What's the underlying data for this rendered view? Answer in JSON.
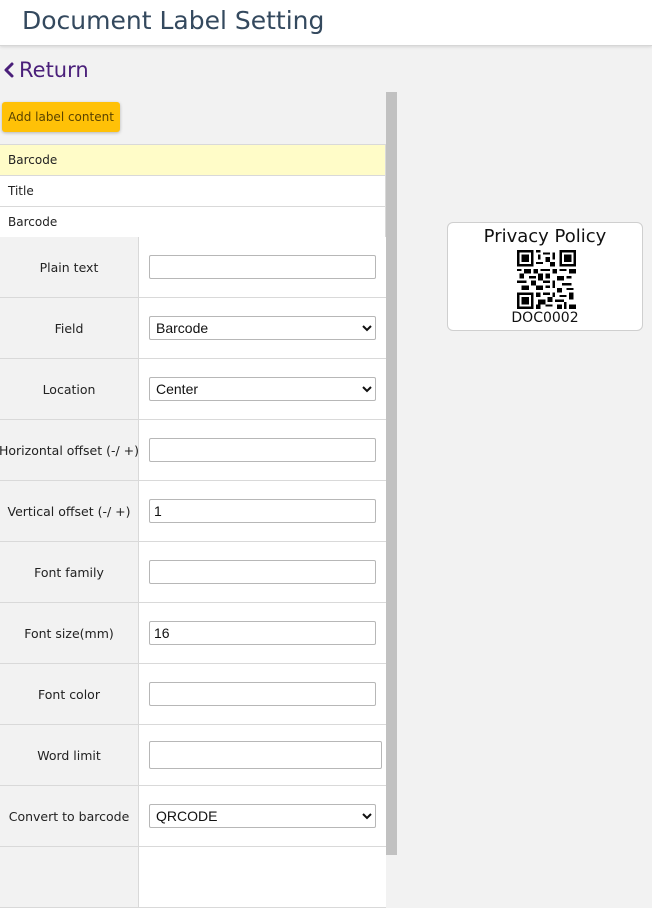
{
  "page": {
    "title": "Document Label Setting"
  },
  "nav": {
    "return_label": "Return"
  },
  "panel": {
    "add_button_label": "Add label content",
    "items": [
      {
        "label": "Barcode",
        "selected": true
      },
      {
        "label": "Title",
        "selected": false
      },
      {
        "label": "Barcode",
        "selected": false
      }
    ]
  },
  "form": {
    "plain_text": {
      "label": "Plain text",
      "value": ""
    },
    "field": {
      "label": "Field",
      "value": "Barcode"
    },
    "location": {
      "label": "Location",
      "value": "Center"
    },
    "horizontal_offset": {
      "label": "Horizontal offset (-/ +)",
      "value": ""
    },
    "vertical_offset": {
      "label": "Vertical offset (-/ +)",
      "value": "1"
    },
    "font_family": {
      "label": "Font family",
      "value": ""
    },
    "font_size": {
      "label": "Font size(mm)",
      "value": "16"
    },
    "font_color": {
      "label": "Font color",
      "value": ""
    },
    "word_limit": {
      "label": "Word limit",
      "value": ""
    },
    "convert_to_barcode": {
      "label": "Convert to barcode",
      "value": "QRCODE"
    }
  },
  "preview": {
    "title": "Privacy Policy",
    "code": "DOC0002"
  },
  "colors": {
    "accent_button": "#ffc107",
    "selected_row": "#fffcc8",
    "return_link": "#4a1f7a",
    "title_text": "#34495e"
  },
  "icons": {
    "return": "chevron-left-icon",
    "preview_code": "qr-code-icon"
  }
}
